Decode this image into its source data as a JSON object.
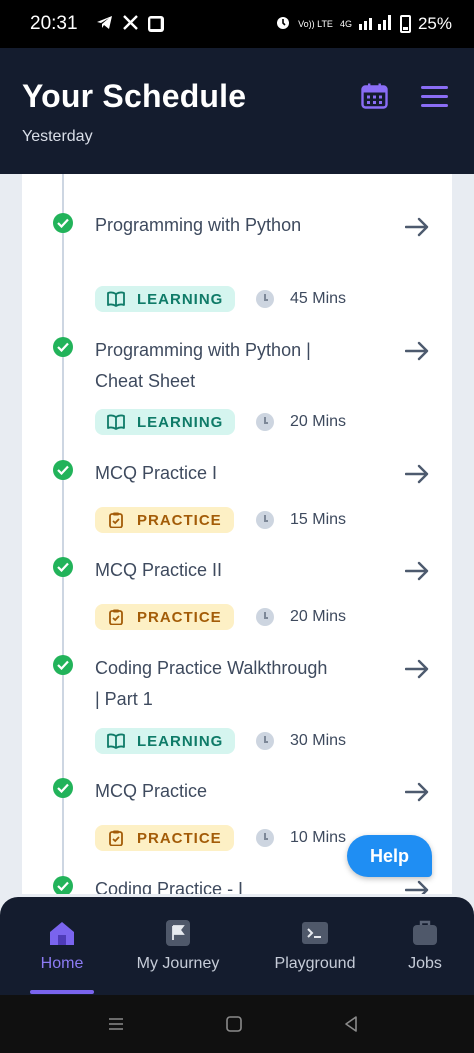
{
  "status_bar": {
    "time": "20:31",
    "network_label": "Vo)) LTE",
    "signal_label": "4G",
    "battery": "25%",
    "icons": [
      "telegram-icon",
      "x-icon",
      "app-badge-icon",
      "alarm-icon",
      "signal-icon",
      "battery-icon"
    ]
  },
  "header": {
    "title": "Your Schedule",
    "subtitle": "Yesterday",
    "icons": [
      "calendar-icon",
      "menu-icon"
    ]
  },
  "schedule": [
    {
      "title": "Programming with Python",
      "type": "LEARNING",
      "duration": "45 Mins",
      "completed": true
    },
    {
      "title": "Programming with Python | Cheat Sheet",
      "type": "LEARNING",
      "duration": "20 Mins",
      "completed": true
    },
    {
      "title": "MCQ Practice I",
      "type": "PRACTICE",
      "duration": "15 Mins",
      "completed": true
    },
    {
      "title": "MCQ Practice II",
      "type": "PRACTICE",
      "duration": "20 Mins",
      "completed": true
    },
    {
      "title": "Coding Practice Walkthrough | Part 1",
      "type": "LEARNING",
      "duration": "30 Mins",
      "completed": true
    },
    {
      "title": "MCQ Practice",
      "type": "PRACTICE",
      "duration": "10 Mins",
      "completed": true
    },
    {
      "title": "Coding Practice - I",
      "type": "",
      "duration": "",
      "completed": true
    }
  ],
  "help_button": "Help",
  "bottom_nav": [
    {
      "label": "Home",
      "icon": "home-icon",
      "active": true
    },
    {
      "label": "My Journey",
      "icon": "flag-icon",
      "active": false
    },
    {
      "label": "Playground",
      "icon": "terminal-icon",
      "active": false
    },
    {
      "label": "Jobs",
      "icon": "briefcase-icon",
      "active": false
    }
  ],
  "colors": {
    "header_bg": "#141c2e",
    "accent": "#7a64ee",
    "check": "#22b35a",
    "learning_bg": "#d5f5ef",
    "learning_text": "#0f7b68",
    "practice_bg": "#fdf0c5",
    "practice_text": "#a35c08",
    "help_bg": "#1f8ef3"
  }
}
